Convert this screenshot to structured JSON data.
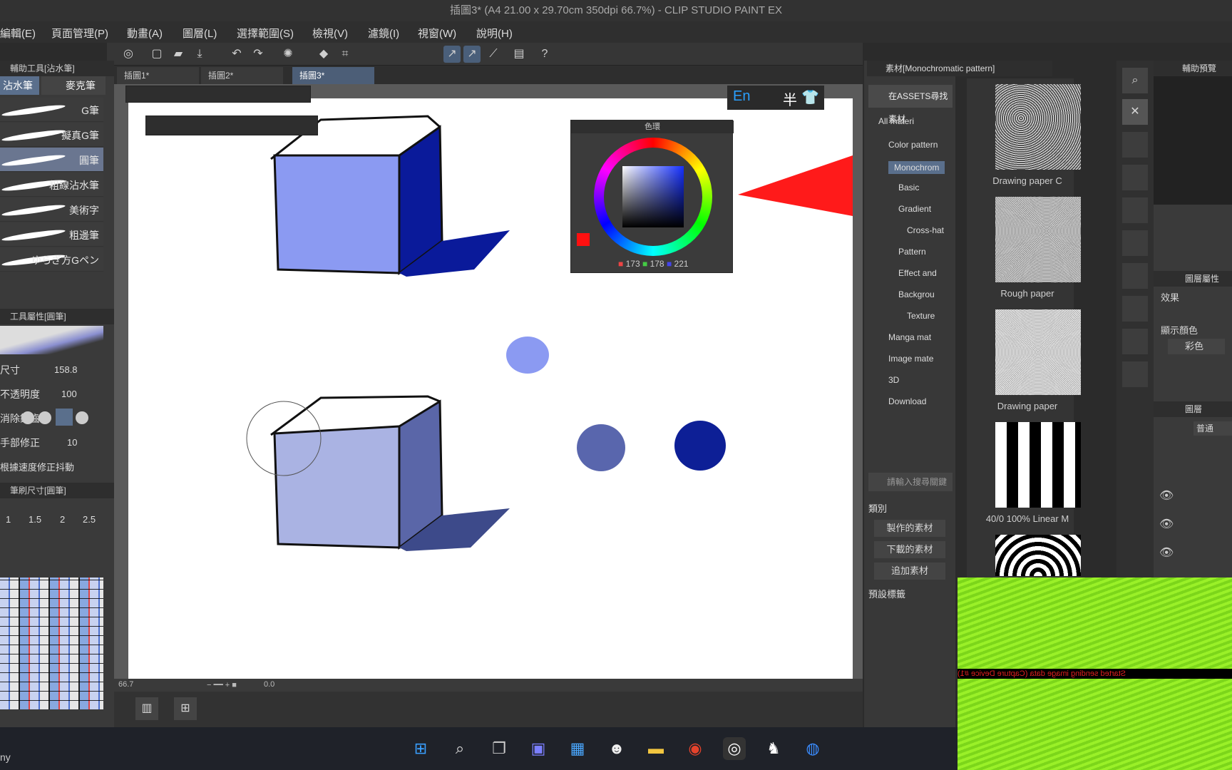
{
  "window": {
    "title": "插圖3* (A4 21.00 x 29.70cm 350dpi 66.7%) - CLIP STUDIO PAINT EX"
  },
  "menu": [
    "編輯(E)",
    "頁面管理(P)",
    "動畫(A)",
    "圖層(L)",
    "選擇範圍(S)",
    "檢視(V)",
    "濾鏡(I)",
    "視窗(W)",
    "說明(H)"
  ],
  "tabs": [
    {
      "label": "插圖1*"
    },
    {
      "label": "插圖2*"
    },
    {
      "label": "插圖3*"
    }
  ],
  "left_panel": {
    "sub_tool_title": "輔助工具[沾水筆]",
    "tab_ink": "沾水筆",
    "tab_marker": "麥克筆",
    "brushes": [
      "G筆",
      "擬真G筆",
      "圓筆",
      "粗線沾水筆",
      "美術字",
      "粗邊筆",
      "ゆらぎ方Gペン"
    ],
    "tool_prop_title": "工具屬性[圓筆]",
    "size_label": "尺寸",
    "size_value": "158.8",
    "opacity_label": "不透明度",
    "opacity_value": "100",
    "antialias_label": "消除鋸齒",
    "stabil_label": "手部修正",
    "stabil_value": "10",
    "speed_label": "根據速度修正抖動",
    "brush_size_title": "筆刷尺寸[圓筆]",
    "brush_sizes": [
      "1",
      "1.5",
      "2",
      "2.5"
    ]
  },
  "color_wheel": {
    "title": "色環",
    "r": "173",
    "g": "178",
    "b": "221"
  },
  "ime": {
    "en": "En",
    "half": "半"
  },
  "bottom": {
    "zoom": "66.7",
    "angle": "0.0"
  },
  "materials": {
    "header": "素材[Monochromatic pattern]",
    "assets_button": "在ASSETS尋找素材",
    "tree": [
      "All materi",
      "Color pattern",
      "Monochrom",
      "Basic",
      "Gradient",
      "Cross-hat",
      "Pattern",
      "Effect and",
      "Backgrou",
      "Texture",
      "Manga mat",
      "Image mate",
      "3D",
      "Download"
    ],
    "search_placeholder": "請輸入搜尋關鍵",
    "category_label": "類別",
    "cat_buttons": [
      "製作的素材",
      "下載的素材",
      "追加素材"
    ],
    "preset_label": "預設標籤",
    "previews": [
      "Drawing paper C",
      "Rough paper",
      "Drawing paper",
      "40/0 100% Linear M"
    ]
  },
  "far_right": {
    "nav_title": "輔助預覽",
    "layer_prop_title": "圖層屬性",
    "effect_label": "效果",
    "display_color_label": "顯示顏色",
    "color_value": "彩色",
    "layer_title": "圖層",
    "blend_value": "普通"
  },
  "capture_text": "Started sending image data (Capture Device #1)",
  "taskbar_left_text": "ny",
  "colors": {
    "cube1_front": "#8b9af2",
    "cube1_side": "#0a1a9a",
    "cube2_front": "#aab3e3",
    "cube2_side": "#5a66a8",
    "dot1": "#8b9af2",
    "dot2": "#5966ad",
    "dot3": "#0d1f96",
    "red_shape": "#ff1a1a"
  }
}
